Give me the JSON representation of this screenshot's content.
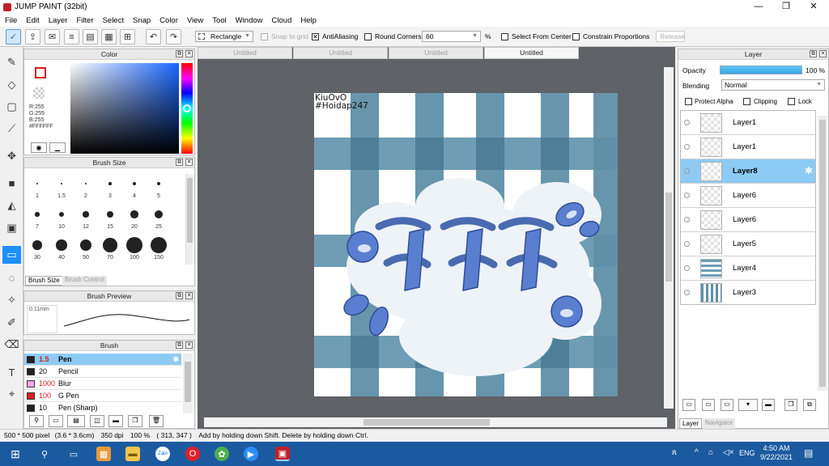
{
  "window": {
    "title": "JUMP PAINT (32bit)",
    "minimize": "—",
    "maximize": "❐",
    "close": "✕"
  },
  "menu": [
    "File",
    "Edit",
    "Layer",
    "Filter",
    "Select",
    "Snap",
    "Color",
    "View",
    "Tool",
    "Window",
    "Cloud",
    "Help"
  ],
  "toolbar": {
    "shape_value": "Rectangle",
    "snap_to_grid": "Snap to grid",
    "antialiasing": "AntiAliasing",
    "round_corners": "Round Corners",
    "round_value": "60",
    "percent": "%",
    "select_from_center": "Select From Center",
    "constrain": "Constrain Proportions",
    "release": "Release"
  },
  "color_panel": {
    "title": "Color",
    "r": "R:255",
    "g": "G:255",
    "b": "B:255",
    "hex": "#FFFFFF"
  },
  "brush_size_panel": {
    "title": "Brush Size",
    "sizes": [
      "1",
      "1.5",
      "2",
      "3",
      "4",
      "5",
      "7",
      "10",
      "12",
      "15",
      "20",
      "25",
      "30",
      "40",
      "50",
      "70",
      "100",
      "150"
    ],
    "tab_active": "Brush Size",
    "tab_inactive": "Brush Control"
  },
  "brush_preview_panel": {
    "title": "Brush Preview",
    "size_label": "0.11mm"
  },
  "brush_panel": {
    "title": "Brush",
    "items": [
      {
        "size": "1.5",
        "name": "Pen",
        "color": "#222222"
      },
      {
        "size": "20",
        "name": "Pencil",
        "color": "#222222"
      },
      {
        "size": "1000",
        "name": "Blur",
        "color": "#f3a6e6"
      },
      {
        "size": "100",
        "name": "G Pen",
        "color": "#e02020"
      },
      {
        "size": "10",
        "name": "Pen (Sharp)",
        "color": "#222222"
      }
    ]
  },
  "doc_tabs": [
    "Untitled",
    "Untitled",
    "Untitled",
    "Untitled"
  ],
  "canvas": {
    "watermark_line1": "KiuOvO",
    "watermark_line2": "#Hoidap247"
  },
  "layer_panel": {
    "title": "Layer",
    "opacity_label": "Opacity",
    "opacity_value": "100 %",
    "blending_label": "Blending",
    "blending_value": "Normal",
    "protect_alpha": "Protect Alpha",
    "clipping": "Clipping",
    "lock": "Lock",
    "layers": [
      "Layer1",
      "Layer1",
      "Layer8",
      "Layer6",
      "Layer6",
      "Layer5",
      "Layer4",
      "Layer3"
    ],
    "selected_index": 2,
    "tab_active": "Layer",
    "tab_inactive": "Navigator"
  },
  "status": {
    "canvas_size": "500 * 500 pixel",
    "dims": "(3.6 * 3.6cm)",
    "dpi": "350 dpi",
    "zoom": "100 %",
    "coords": "( 313, 347 )",
    "hint": "Add by holding down Shift. Delete by holding down Ctrl."
  },
  "taskbar": {
    "lang": "ENG",
    "time": "4:50 AM",
    "date": "9/22/2021"
  },
  "colors": {
    "accent": "#1e90ff",
    "selected_row": "#8dcbf5",
    "plaid_blue": "#5f8fa8",
    "taskbar": "#1c5aa0"
  }
}
